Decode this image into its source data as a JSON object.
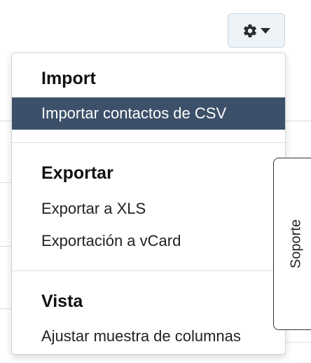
{
  "dropdown": {
    "sections": [
      {
        "header": "Import",
        "items": [
          {
            "label": "Importar contactos de CSV",
            "active": true
          }
        ]
      },
      {
        "header": "Exportar",
        "items": [
          {
            "label": "Exportar a XLS"
          },
          {
            "label": "Exportación a vCard"
          }
        ]
      },
      {
        "header": "Vista",
        "items": [
          {
            "label": "Ajustar muestra de columnas"
          }
        ]
      }
    ]
  },
  "toolbar": {
    "settings_icon": "gear-icon",
    "caret_icon": "caret-down-icon"
  },
  "support_tab": {
    "label": "Soporte"
  },
  "colors": {
    "active_item_bg": "#3c5069",
    "button_bg": "#eef3f7"
  }
}
